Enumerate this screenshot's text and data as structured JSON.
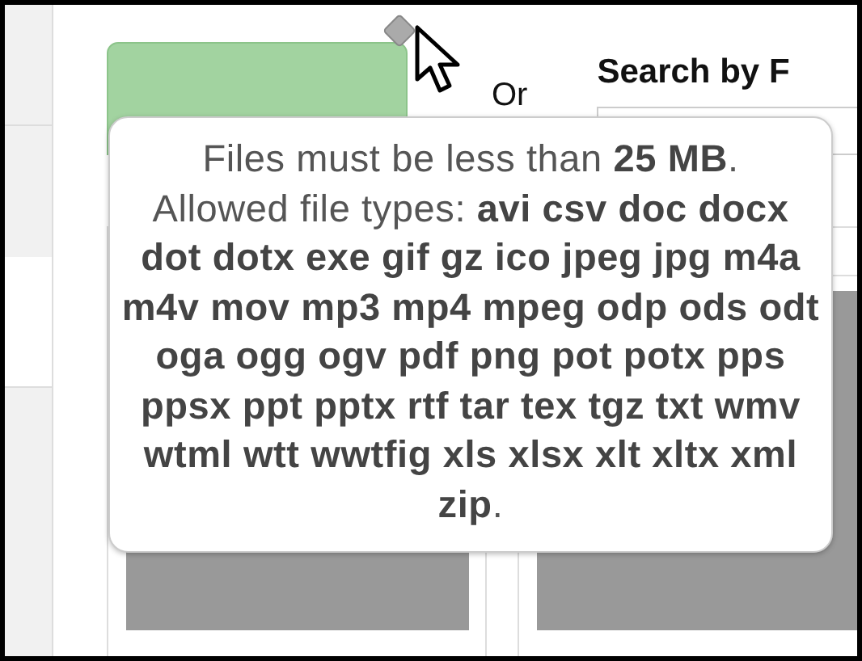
{
  "separator": "Or",
  "search": {
    "heading": "Search by F"
  },
  "tooltip": {
    "paragraphs": [
      "Files must be less than **25 MB**.",
      "Allowed file types: **avi csv doc docx dot dotx exe gif gz ico jpeg jpg m4a m4v mov mp3 mp4 mpeg odp ods odt oga ogg ogv pdf png pot potx pps ppsx ppt pptx rtf tar tex tgz txt wmv wtml wtt wwtfig xls xlsx xlt xltx xml zip**."
    ]
  }
}
